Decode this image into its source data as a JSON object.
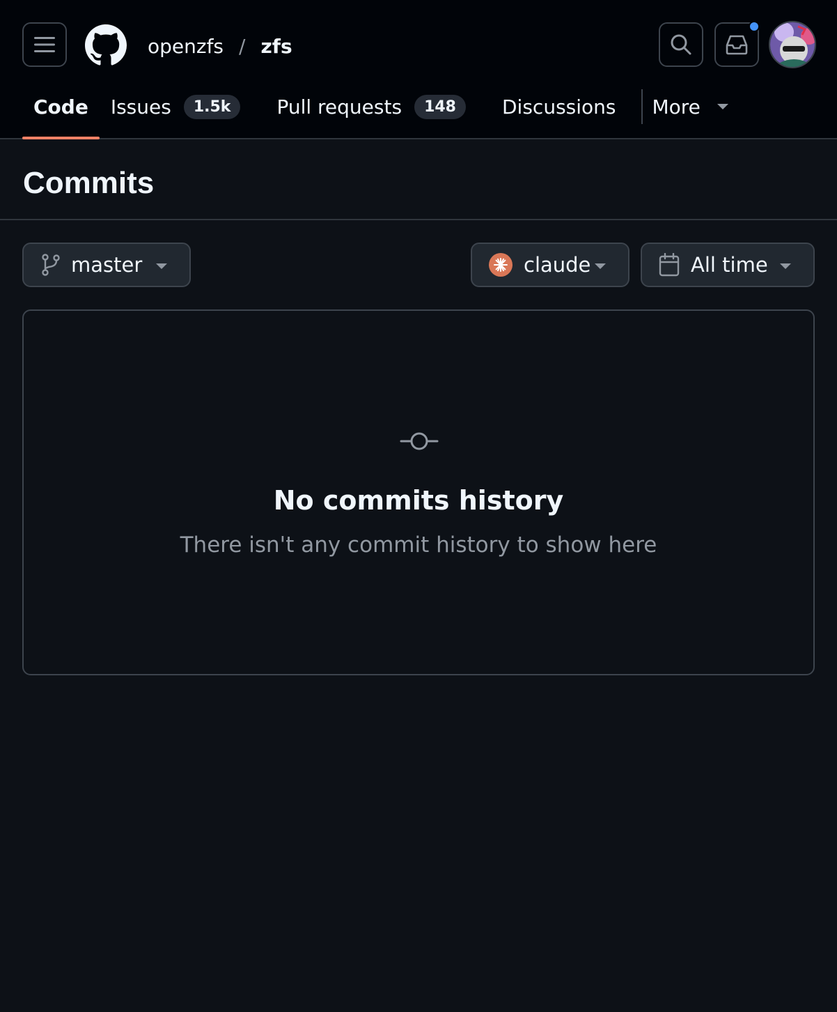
{
  "header": {
    "owner": "openzfs",
    "separator": "/",
    "repo": "zfs"
  },
  "tabs": [
    {
      "label": "Code"
    },
    {
      "label": "Issues",
      "count": "1.5k"
    },
    {
      "label": "Pull requests",
      "count": "148"
    },
    {
      "label": "Discussions"
    },
    {
      "label": "More"
    }
  ],
  "page": {
    "title": "Commits"
  },
  "filters": {
    "branch": "master",
    "author": "claude",
    "time": "All time"
  },
  "empty_state": {
    "title": "No commits history",
    "subtitle": "There isn't any commit history to show here"
  },
  "colors": {
    "background": "#0d1117",
    "header_bg": "#010409",
    "active_tab_underline": "#f78166",
    "notification_dot": "#4493f8",
    "muted_text": "#9198a1"
  },
  "icons": [
    "hamburger-menu-icon",
    "github-logo-icon",
    "search-icon",
    "inbox-icon",
    "git-branch-icon",
    "calendar-icon",
    "git-commit-icon"
  ]
}
